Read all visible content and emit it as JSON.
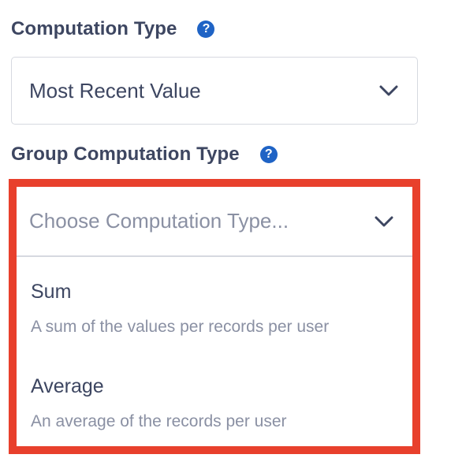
{
  "computation_type": {
    "label": "Computation Type",
    "help_glyph": "?",
    "selected_value": "Most Recent Value"
  },
  "group_computation_type": {
    "label": "Group Computation Type",
    "help_glyph": "?",
    "placeholder": "Choose Computation Type...",
    "options": [
      {
        "title": "Sum",
        "description": "A sum of the values per records per user"
      },
      {
        "title": "Average",
        "description": "An average of the records per user"
      }
    ]
  },
  "colors": {
    "accent_blue": "#1f63c5",
    "highlight_red": "#e8402c",
    "text_dark": "#3d4661",
    "text_muted": "#8a90a3",
    "border": "#d6d9e0"
  },
  "icons": {
    "help": "question-circle-icon",
    "dropdown": "chevron-down-icon"
  }
}
